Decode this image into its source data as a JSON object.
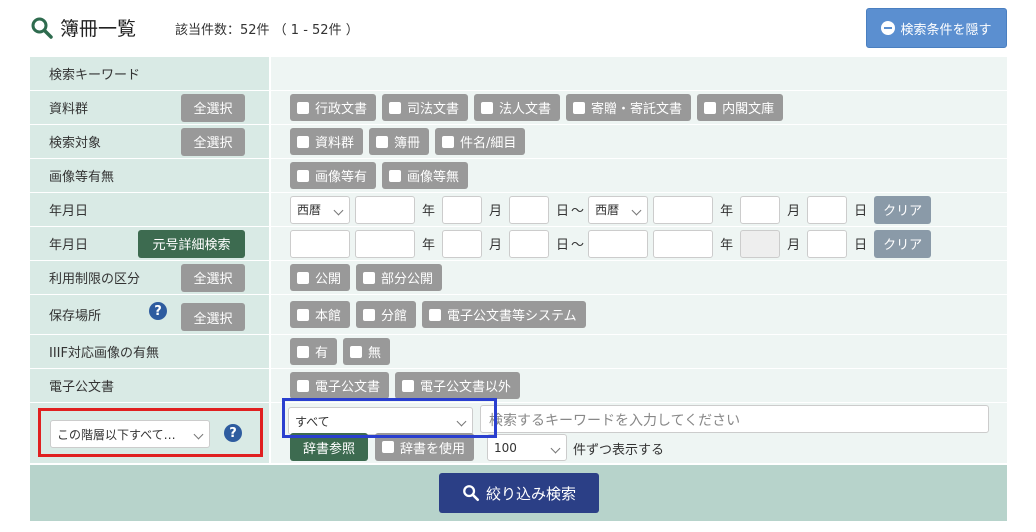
{
  "header": {
    "title": "簿冊一覧",
    "count_text": "該当件数：52件 （ 1 - 52件 ）",
    "hide_button": "検索条件を隠す"
  },
  "rows": {
    "keyword": {
      "label": "検索キーワード"
    },
    "group": {
      "label": "資料群",
      "select_all": "全選択",
      "options": [
        "行政文書",
        "司法文書",
        "法人文書",
        "寄贈・寄託文書",
        "内閣文庫"
      ]
    },
    "target": {
      "label": "検索対象",
      "select_all": "全選択",
      "options": [
        "資料群",
        "簿冊",
        "件名/細目"
      ]
    },
    "image": {
      "label": "画像等有無",
      "options": [
        "画像等有",
        "画像等無"
      ]
    },
    "date1": {
      "label": "年月日",
      "era_from": "西暦",
      "era_to": "西暦",
      "year": "年",
      "month": "月",
      "day": "日",
      "tilde": "～",
      "clear": "クリア"
    },
    "date2": {
      "label": "年月日",
      "gengo_button": "元号詳細検索",
      "year": "年",
      "month": "月",
      "day": "日",
      "tilde": "～",
      "clear": "クリア"
    },
    "restriction": {
      "label": "利用制限の区分",
      "select_all": "全選択",
      "options": [
        "公開",
        "部分公開"
      ]
    },
    "location": {
      "label": "保存場所",
      "help": "?",
      "select_all": "全選択",
      "options": [
        "本館",
        "分館",
        "電子公文書等システム"
      ]
    },
    "iiif": {
      "label": "IIIF対応画像の有無",
      "options": [
        "有",
        "無"
      ]
    },
    "electronic": {
      "label": "電子公文書",
      "options": [
        "電子公文書",
        "電子公文書以外"
      ]
    }
  },
  "search": {
    "scope_select": "この階層以下すべて…",
    "help": "?",
    "field_select": "すべて",
    "keyword_placeholder": "検索するキーワードを入力してください",
    "dict_ref_button": "辞書参照",
    "use_dict_label": "辞書を使用",
    "per_page_value": "100",
    "per_page_suffix": "件ずつ表示する"
  },
  "submit_button": "絞り込み検索",
  "colors": {
    "label_bg": "#d9eae5",
    "value_bg": "#eef5f3",
    "checkbox_btn": "#999999",
    "primary": "#2b3f86",
    "highlight_red": "#e02020",
    "highlight_blue": "#2a3fcf"
  }
}
